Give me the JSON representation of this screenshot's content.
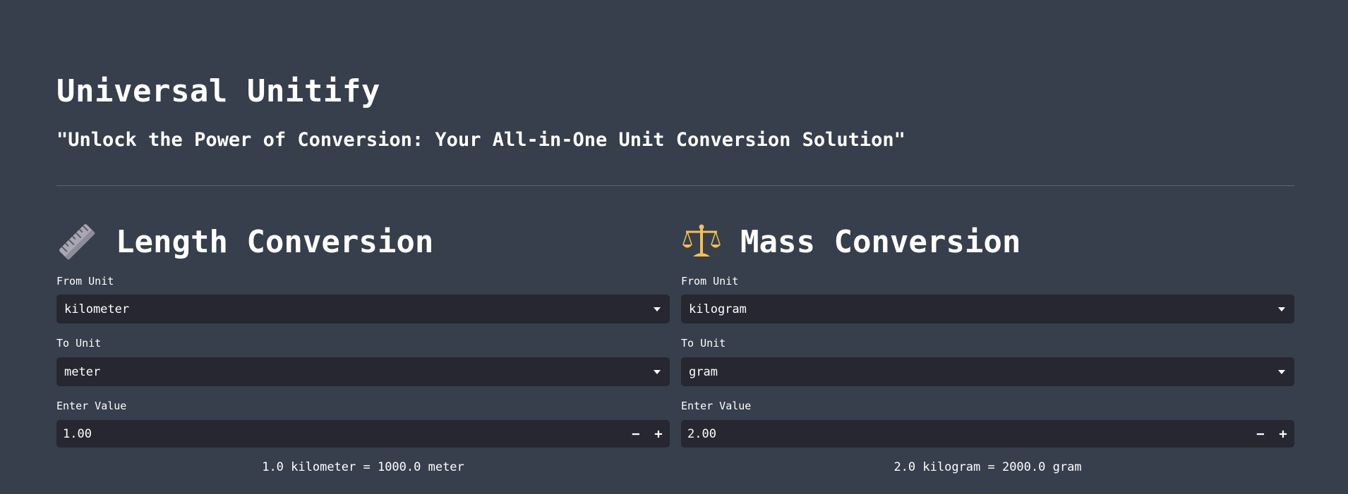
{
  "app": {
    "title": "Universal Unitify",
    "tagline": "\"Unlock the Power of Conversion: Your All-in-One Unit Conversion Solution\""
  },
  "length": {
    "title": "Length Conversion",
    "icon": "ruler-icon",
    "from_label": "From Unit",
    "from_value": "kilometer",
    "to_label": "To Unit",
    "to_value": "meter",
    "value_label": "Enter Value",
    "value": "1.00",
    "minus": "−",
    "plus": "+",
    "result": "1.0 kilometer = 1000.0 meter"
  },
  "mass": {
    "title": "Mass Conversion",
    "icon": "balance-scale-icon",
    "from_label": "From Unit",
    "from_value": "kilogram",
    "to_label": "To Unit",
    "to_value": "gram",
    "value_label": "Enter Value",
    "value": "2.00",
    "minus": "−",
    "plus": "+",
    "result": "2.0 kilogram = 2000.0 gram"
  },
  "colors": {
    "background": "#373e4c",
    "input_background": "#262730",
    "text": "#ffffff",
    "divider": "#5e6676"
  }
}
